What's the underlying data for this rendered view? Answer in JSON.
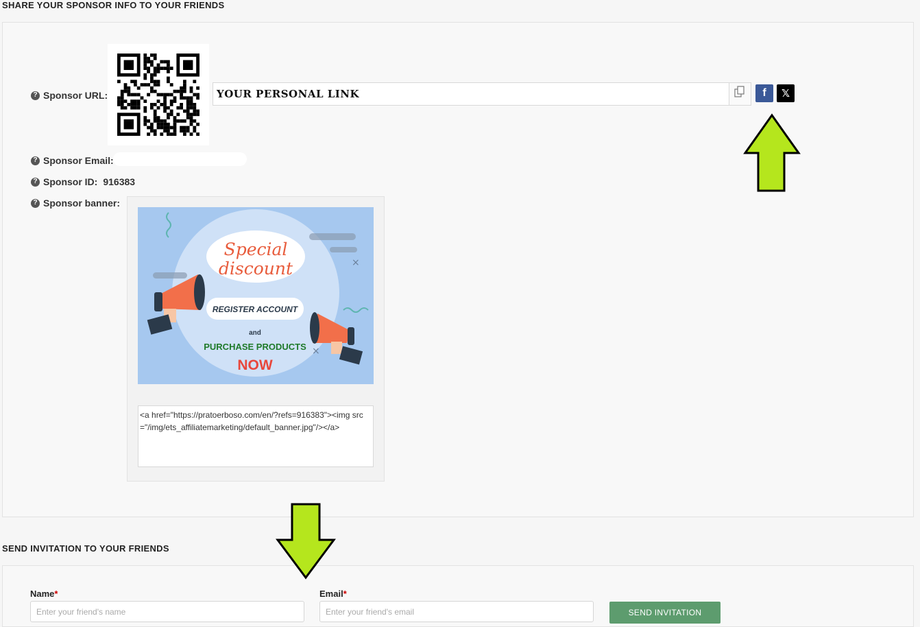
{
  "share_section": {
    "title": "SHARE YOUR SPONSOR INFO TO YOUR FRIENDS",
    "sponsor_url_label": "Sponsor URL:",
    "sponsor_email_label": "Sponsor Email:",
    "sponsor_id_label": "Sponsor ID:",
    "sponsor_id_value": "916383",
    "sponsor_banner_label": "Sponsor banner:",
    "personal_link_text": "YOUR PERSONAL LINK",
    "facebook_glyph": "f",
    "x_glyph": "𝕏",
    "help_glyph": "?"
  },
  "banner": {
    "line1": "Special",
    "line2": "discount",
    "register": "REGISTER ACCOUNT",
    "and": "and",
    "purchase": "PURCHASE PRODUCTS",
    "now": "NOW"
  },
  "banner_code": "<a href=\"https://pratoerboso.com/en/?refs=916383\"><img src =\"/img/ets_affiliatemarketing/default_banner.jpg\"/></a>",
  "invite_section": {
    "title": "SEND INVITATION TO YOUR FRIENDS",
    "name_label": "Name",
    "email_label": "Email",
    "required_mark": "*",
    "name_placeholder": "Enter your friend's name",
    "email_placeholder": "Enter your friend's email",
    "send_button": "SEND INVITATION"
  },
  "colors": {
    "facebook": "#3b5998",
    "x": "#000000",
    "send_button": "#5d9c6e",
    "arrow": "#b5e61d"
  }
}
